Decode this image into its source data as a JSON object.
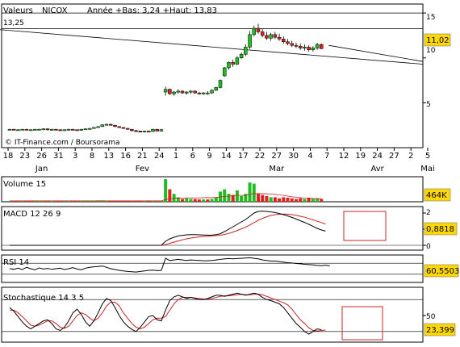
{
  "header": {
    "valeurs_label": "Valeurs",
    "ticker": "NICOX",
    "year_stats": "Année +Bas: 3,24 +Haut: 13,83",
    "ref_level_label": "13,25",
    "watermark": "© IT-Finance.com / Boursorama"
  },
  "colors": {
    "up": "#22bb22",
    "down": "#dd2222",
    "badge": "#ffd800",
    "box": "#cc2222",
    "signal": "#cc2222"
  },
  "chart_data": [
    {
      "type": "candlestick",
      "name": "price",
      "ylim": [
        0,
        16
      ],
      "ytick_labels": [
        "15",
        "10",
        "5"
      ],
      "yticks": [
        15,
        10,
        5
      ],
      "last_value_label": "11,02",
      "ref_lines": [
        15,
        13.25
      ],
      "xtick_labels": [
        "18",
        "23",
        "26",
        "31",
        "3",
        "8",
        "13",
        "16",
        "21",
        "24",
        "1",
        "6",
        "9",
        "14",
        "17",
        "22",
        "27",
        "30",
        "4",
        "7",
        "12",
        "19",
        "24",
        "27",
        "2",
        "5"
      ],
      "month_labels": [
        {
          "label": "Jan",
          "at": 2
        },
        {
          "label": "Fev",
          "at": 8
        },
        {
          "label": "Mar",
          "at": 16
        },
        {
          "label": "Avr",
          "at": 22
        },
        {
          "label": "Mai",
          "at": 25
        }
      ],
      "trendlines": [
        {
          "from": [
            -0.5,
            13.15
          ],
          "to": [
            26.7,
            9.3
          ]
        },
        {
          "from": [
            19.1,
            11.4
          ],
          "to": [
            26.7,
            9.6
          ]
        }
      ],
      "candles": [
        [
          2.0,
          2.1,
          1.95,
          2.05
        ],
        [
          2.05,
          2.1,
          1.95,
          2.0
        ],
        [
          2.0,
          2.05,
          1.9,
          2.0
        ],
        [
          2.0,
          2.1,
          1.95,
          2.05
        ],
        [
          2.05,
          2.1,
          1.95,
          2.0
        ],
        [
          2.0,
          2.05,
          1.9,
          2.0
        ],
        [
          2.0,
          2.1,
          1.95,
          2.05
        ],
        [
          2.05,
          2.1,
          1.95,
          2.05
        ],
        [
          2.05,
          2.15,
          1.95,
          2.1
        ],
        [
          2.1,
          2.15,
          1.9,
          2.0
        ],
        [
          2.0,
          2.1,
          1.9,
          2.05
        ],
        [
          2.05,
          2.1,
          1.95,
          2.0
        ],
        [
          2.0,
          2.05,
          1.85,
          1.95
        ],
        [
          1.95,
          2.05,
          1.9,
          2.0
        ],
        [
          2.0,
          2.1,
          1.95,
          2.05
        ],
        [
          2.05,
          2.1,
          1.95,
          2.0
        ],
        [
          2.0,
          2.05,
          1.9,
          1.95
        ],
        [
          1.95,
          2.1,
          1.9,
          2.05
        ],
        [
          2.05,
          2.15,
          2.0,
          2.1
        ],
        [
          2.1,
          2.2,
          2.0,
          2.15
        ],
        [
          2.15,
          2.3,
          2.1,
          2.25
        ],
        [
          2.25,
          2.4,
          2.2,
          2.35
        ],
        [
          2.35,
          2.6,
          2.3,
          2.55
        ],
        [
          2.55,
          2.7,
          2.5,
          2.6
        ],
        [
          2.6,
          2.7,
          2.45,
          2.5
        ],
        [
          2.5,
          2.55,
          2.3,
          2.35
        ],
        [
          2.35,
          2.4,
          2.2,
          2.25
        ],
        [
          2.25,
          2.3,
          2.1,
          2.15
        ],
        [
          2.15,
          2.2,
          2.0,
          2.05
        ],
        [
          2.05,
          2.1,
          1.8,
          1.9
        ],
        [
          1.9,
          2.0,
          1.75,
          1.85
        ],
        [
          1.85,
          1.9,
          1.7,
          1.8
        ],
        [
          1.8,
          1.9,
          1.7,
          1.85
        ],
        [
          1.85,
          1.9,
          1.75,
          1.8
        ],
        [
          1.8,
          2.1,
          1.75,
          2.05
        ],
        [
          2.05,
          2.1,
          1.8,
          1.85
        ],
        [
          1.85,
          2.1,
          1.8,
          2.0
        ],
        [
          6.2,
          6.8,
          5.8,
          6.5
        ],
        [
          6.5,
          6.6,
          5.9,
          6.0
        ],
        [
          6.0,
          6.3,
          5.8,
          6.2
        ],
        [
          6.2,
          6.5,
          6.0,
          6.3
        ],
        [
          6.3,
          6.4,
          6.0,
          6.1
        ],
        [
          6.1,
          6.3,
          5.9,
          6.2
        ],
        [
          6.2,
          6.4,
          6.0,
          6.3
        ],
        [
          6.3,
          6.4,
          6.0,
          6.1
        ],
        [
          6.1,
          6.2,
          5.9,
          6.0
        ],
        [
          6.0,
          6.2,
          5.9,
          6.1
        ],
        [
          6.1,
          6.3,
          5.9,
          6.1
        ],
        [
          6.1,
          6.5,
          6.0,
          6.4
        ],
        [
          6.4,
          6.8,
          6.3,
          6.7
        ],
        [
          6.7,
          7.6,
          6.6,
          7.5
        ],
        [
          8.0,
          9.0,
          7.9,
          8.9
        ],
        [
          8.9,
          9.6,
          8.7,
          9.5
        ],
        [
          9.5,
          9.8,
          9.0,
          9.3
        ],
        [
          9.3,
          10.2,
          9.2,
          10.0
        ],
        [
          10.0,
          10.6,
          9.9,
          10.4
        ],
        [
          10.4,
          11.5,
          10.2,
          11.2
        ],
        [
          11.2,
          13.0,
          11.0,
          12.6
        ],
        [
          12.6,
          13.6,
          12.4,
          13.3
        ],
        [
          13.3,
          13.8,
          12.7,
          12.9
        ],
        [
          12.9,
          13.2,
          12.3,
          12.5
        ],
        [
          12.5,
          12.9,
          12.0,
          12.2
        ],
        [
          12.2,
          12.8,
          11.9,
          12.6
        ],
        [
          12.6,
          12.9,
          12.1,
          12.3
        ],
        [
          12.3,
          12.7,
          11.9,
          12.1
        ],
        [
          12.1,
          12.4,
          11.6,
          11.8
        ],
        [
          11.8,
          12.1,
          11.4,
          11.6
        ],
        [
          11.6,
          11.9,
          11.2,
          11.4
        ],
        [
          11.4,
          11.7,
          11.1,
          11.3
        ],
        [
          11.3,
          11.6,
          10.9,
          11.1
        ],
        [
          11.1,
          11.5,
          10.8,
          11.2
        ],
        [
          11.2,
          11.4,
          10.7,
          10.9
        ],
        [
          10.9,
          11.3,
          10.7,
          11.1
        ],
        [
          11.1,
          11.7,
          10.9,
          11.5
        ],
        [
          11.5,
          11.6,
          11.0,
          11.02
        ]
      ]
    },
    {
      "type": "bar",
      "name": "Volume 15",
      "title": "Volume 15",
      "last_value_label": "464K",
      "values": [
        0.04,
        0.03,
        0.03,
        0.04,
        0.03,
        0.03,
        0.04,
        0.03,
        0.04,
        0.03,
        0.03,
        0.03,
        0.03,
        0.04,
        0.03,
        0.03,
        0.03,
        0.04,
        0.05,
        0.04,
        0.05,
        0.06,
        0.06,
        0.05,
        0.04,
        0.04,
        0.05,
        0.04,
        0.04,
        0.03,
        0.03,
        0.04,
        0.03,
        0.04,
        0.04,
        0.03,
        0.04,
        1.0,
        0.55,
        0.35,
        0.2,
        0.12,
        0.15,
        0.12,
        0.12,
        0.1,
        0.1,
        0.1,
        0.12,
        0.2,
        0.45,
        0.55,
        0.35,
        0.3,
        0.5,
        0.25,
        0.35,
        0.85,
        0.8,
        0.35,
        0.3,
        0.25,
        0.2,
        0.2,
        0.15,
        0.2,
        0.18,
        0.15,
        0.12,
        0.15,
        0.12,
        0.18,
        0.12,
        0.15,
        0.12
      ],
      "directions": [
        1,
        -1,
        -1,
        1,
        -1,
        -1,
        1,
        1,
        1,
        -1,
        1,
        -1,
        -1,
        1,
        1,
        -1,
        -1,
        1,
        1,
        1,
        1,
        1,
        1,
        1,
        -1,
        -1,
        -1,
        -1,
        -1,
        -1,
        -1,
        -1,
        1,
        -1,
        1,
        -1,
        1,
        1,
        -1,
        1,
        1,
        -1,
        1,
        1,
        -1,
        -1,
        1,
        -1,
        1,
        1,
        1,
        1,
        1,
        -1,
        1,
        1,
        1,
        1,
        1,
        -1,
        -1,
        -1,
        1,
        -1,
        -1,
        -1,
        -1,
        -1,
        -1,
        -1,
        1,
        -1,
        1,
        1,
        -1
      ],
      "average_line": [
        0.04,
        0.04,
        0.04,
        0.04,
        0.04,
        0.04,
        0.04,
        0.04,
        0.04,
        0.04,
        0.04,
        0.04,
        0.04,
        0.04,
        0.04,
        0.04,
        0.04,
        0.04,
        0.04,
        0.04,
        0.04,
        0.04,
        0.04,
        0.04,
        0.04,
        0.04,
        0.04,
        0.04,
        0.04,
        0.04,
        0.04,
        0.04,
        0.04,
        0.04,
        0.04,
        0.04,
        0.04,
        0.1,
        0.13,
        0.15,
        0.16,
        0.16,
        0.17,
        0.17,
        0.17,
        0.17,
        0.18,
        0.18,
        0.18,
        0.19,
        0.21,
        0.24,
        0.25,
        0.26,
        0.28,
        0.28,
        0.28,
        0.32,
        0.36,
        0.36,
        0.36,
        0.35,
        0.34,
        0.33,
        0.3,
        0.28,
        0.25,
        0.22,
        0.2,
        0.18,
        0.16,
        0.15,
        0.14,
        0.14,
        0.13
      ]
    },
    {
      "type": "line",
      "name": "MACD 12 26 9",
      "title": "MACD 12 26 9",
      "last_value_label": "0,8818",
      "ylim": [
        -0.2,
        2.3
      ],
      "yticks": [
        2,
        1,
        0
      ],
      "ytick_labels": [
        "2",
        "1",
        "0"
      ],
      "series_macd": [
        0,
        0,
        0,
        0,
        0,
        0,
        0,
        0,
        0,
        0,
        0,
        0,
        0,
        0,
        0,
        0,
        0,
        0,
        0,
        0,
        0,
        0,
        0,
        0,
        0,
        0,
        0,
        0,
        0,
        0,
        0,
        0,
        0,
        0,
        0,
        0,
        0,
        0.25,
        0.4,
        0.5,
        0.58,
        0.62,
        0.65,
        0.66,
        0.66,
        0.65,
        0.64,
        0.63,
        0.63,
        0.66,
        0.72,
        0.85,
        1.0,
        1.15,
        1.3,
        1.45,
        1.6,
        1.8,
        2.0,
        2.1,
        2.12,
        2.1,
        2.07,
        2.03,
        1.97,
        1.9,
        1.82,
        1.73,
        1.63,
        1.52,
        1.42,
        1.3,
        1.18,
        1.05,
        0.95,
        0.88
      ],
      "series_signal": [
        0,
        0,
        0,
        0,
        0,
        0,
        0,
        0,
        0,
        0,
        0,
        0,
        0,
        0,
        0,
        0,
        0,
        0,
        0,
        0,
        0,
        0,
        0,
        0,
        0,
        0,
        0,
        0,
        0,
        0,
        0,
        0,
        0,
        0,
        0,
        0,
        0,
        0.05,
        0.12,
        0.2,
        0.27,
        0.34,
        0.4,
        0.45,
        0.49,
        0.52,
        0.55,
        0.57,
        0.59,
        0.6,
        0.63,
        0.67,
        0.74,
        0.82,
        0.92,
        1.02,
        1.13,
        1.26,
        1.4,
        1.55,
        1.67,
        1.77,
        1.85,
        1.9,
        1.93,
        1.94,
        1.93,
        1.9,
        1.86,
        1.8,
        1.74,
        1.66,
        1.58,
        1.49,
        1.41,
        1.32
      ]
    },
    {
      "type": "line",
      "name": "RSI 14",
      "title": "RSI 14",
      "last_value_label": "60,5503",
      "ylim": [
        0,
        100
      ],
      "ref_lines": [
        70,
        30
      ],
      "values": [
        50,
        48,
        52,
        47,
        55,
        50,
        46,
        53,
        49,
        51,
        48,
        50,
        52,
        47,
        50,
        54,
        49,
        46,
        52,
        55,
        57,
        58,
        60,
        55,
        50,
        47,
        44,
        42,
        40,
        39,
        38,
        40,
        42,
        44,
        45,
        43,
        44,
        88,
        80,
        82,
        84,
        82,
        80,
        82,
        81,
        80,
        79,
        79,
        80,
        82,
        84,
        86,
        87,
        86,
        87,
        88,
        89,
        90,
        88,
        86,
        82,
        80,
        78,
        78,
        76,
        74,
        72,
        71,
        69,
        68,
        66,
        65,
        64,
        62,
        61,
        63,
        60.55
      ]
    },
    {
      "type": "line",
      "name": "Stochastique 14 3 5",
      "title": "Stochastique 14 3 5",
      "last_value_label": "23,399",
      "ylim": [
        0,
        100
      ],
      "yticks": [
        50
      ],
      "ytick_labels": [
        "50"
      ],
      "ref_lines": [
        80,
        20
      ],
      "series_k": [
        65,
        58,
        48,
        38,
        30,
        25,
        30,
        35,
        40,
        42,
        35,
        25,
        22,
        28,
        40,
        55,
        62,
        52,
        38,
        30,
        40,
        55,
        72,
        82,
        78,
        65,
        50,
        38,
        30,
        24,
        20,
        28,
        38,
        48,
        50,
        42,
        40,
        60,
        78,
        85,
        88,
        85,
        82,
        84,
        82,
        80,
        80,
        82,
        85,
        88,
        88,
        86,
        88,
        90,
        92,
        90,
        88,
        90,
        92,
        90,
        84,
        80,
        78,
        75,
        72,
        65,
        55,
        45,
        35,
        28,
        20,
        15,
        20,
        25,
        23.4
      ],
      "series_d": [
        60,
        60,
        55,
        48,
        40,
        32,
        30,
        32,
        36,
        40,
        40,
        35,
        28,
        26,
        30,
        40,
        50,
        55,
        52,
        45,
        40,
        45,
        55,
        68,
        75,
        75,
        68,
        55,
        45,
        35,
        28,
        25,
        28,
        35,
        42,
        45,
        45,
        48,
        60,
        72,
        80,
        84,
        84,
        84,
        83,
        82,
        81,
        81,
        82,
        84,
        86,
        87,
        87,
        88,
        89,
        90,
        89,
        89,
        90,
        90,
        89,
        86,
        83,
        80,
        77,
        74,
        70,
        62,
        52,
        42,
        35,
        27,
        22,
        21,
        22,
        22.7
      ]
    }
  ]
}
